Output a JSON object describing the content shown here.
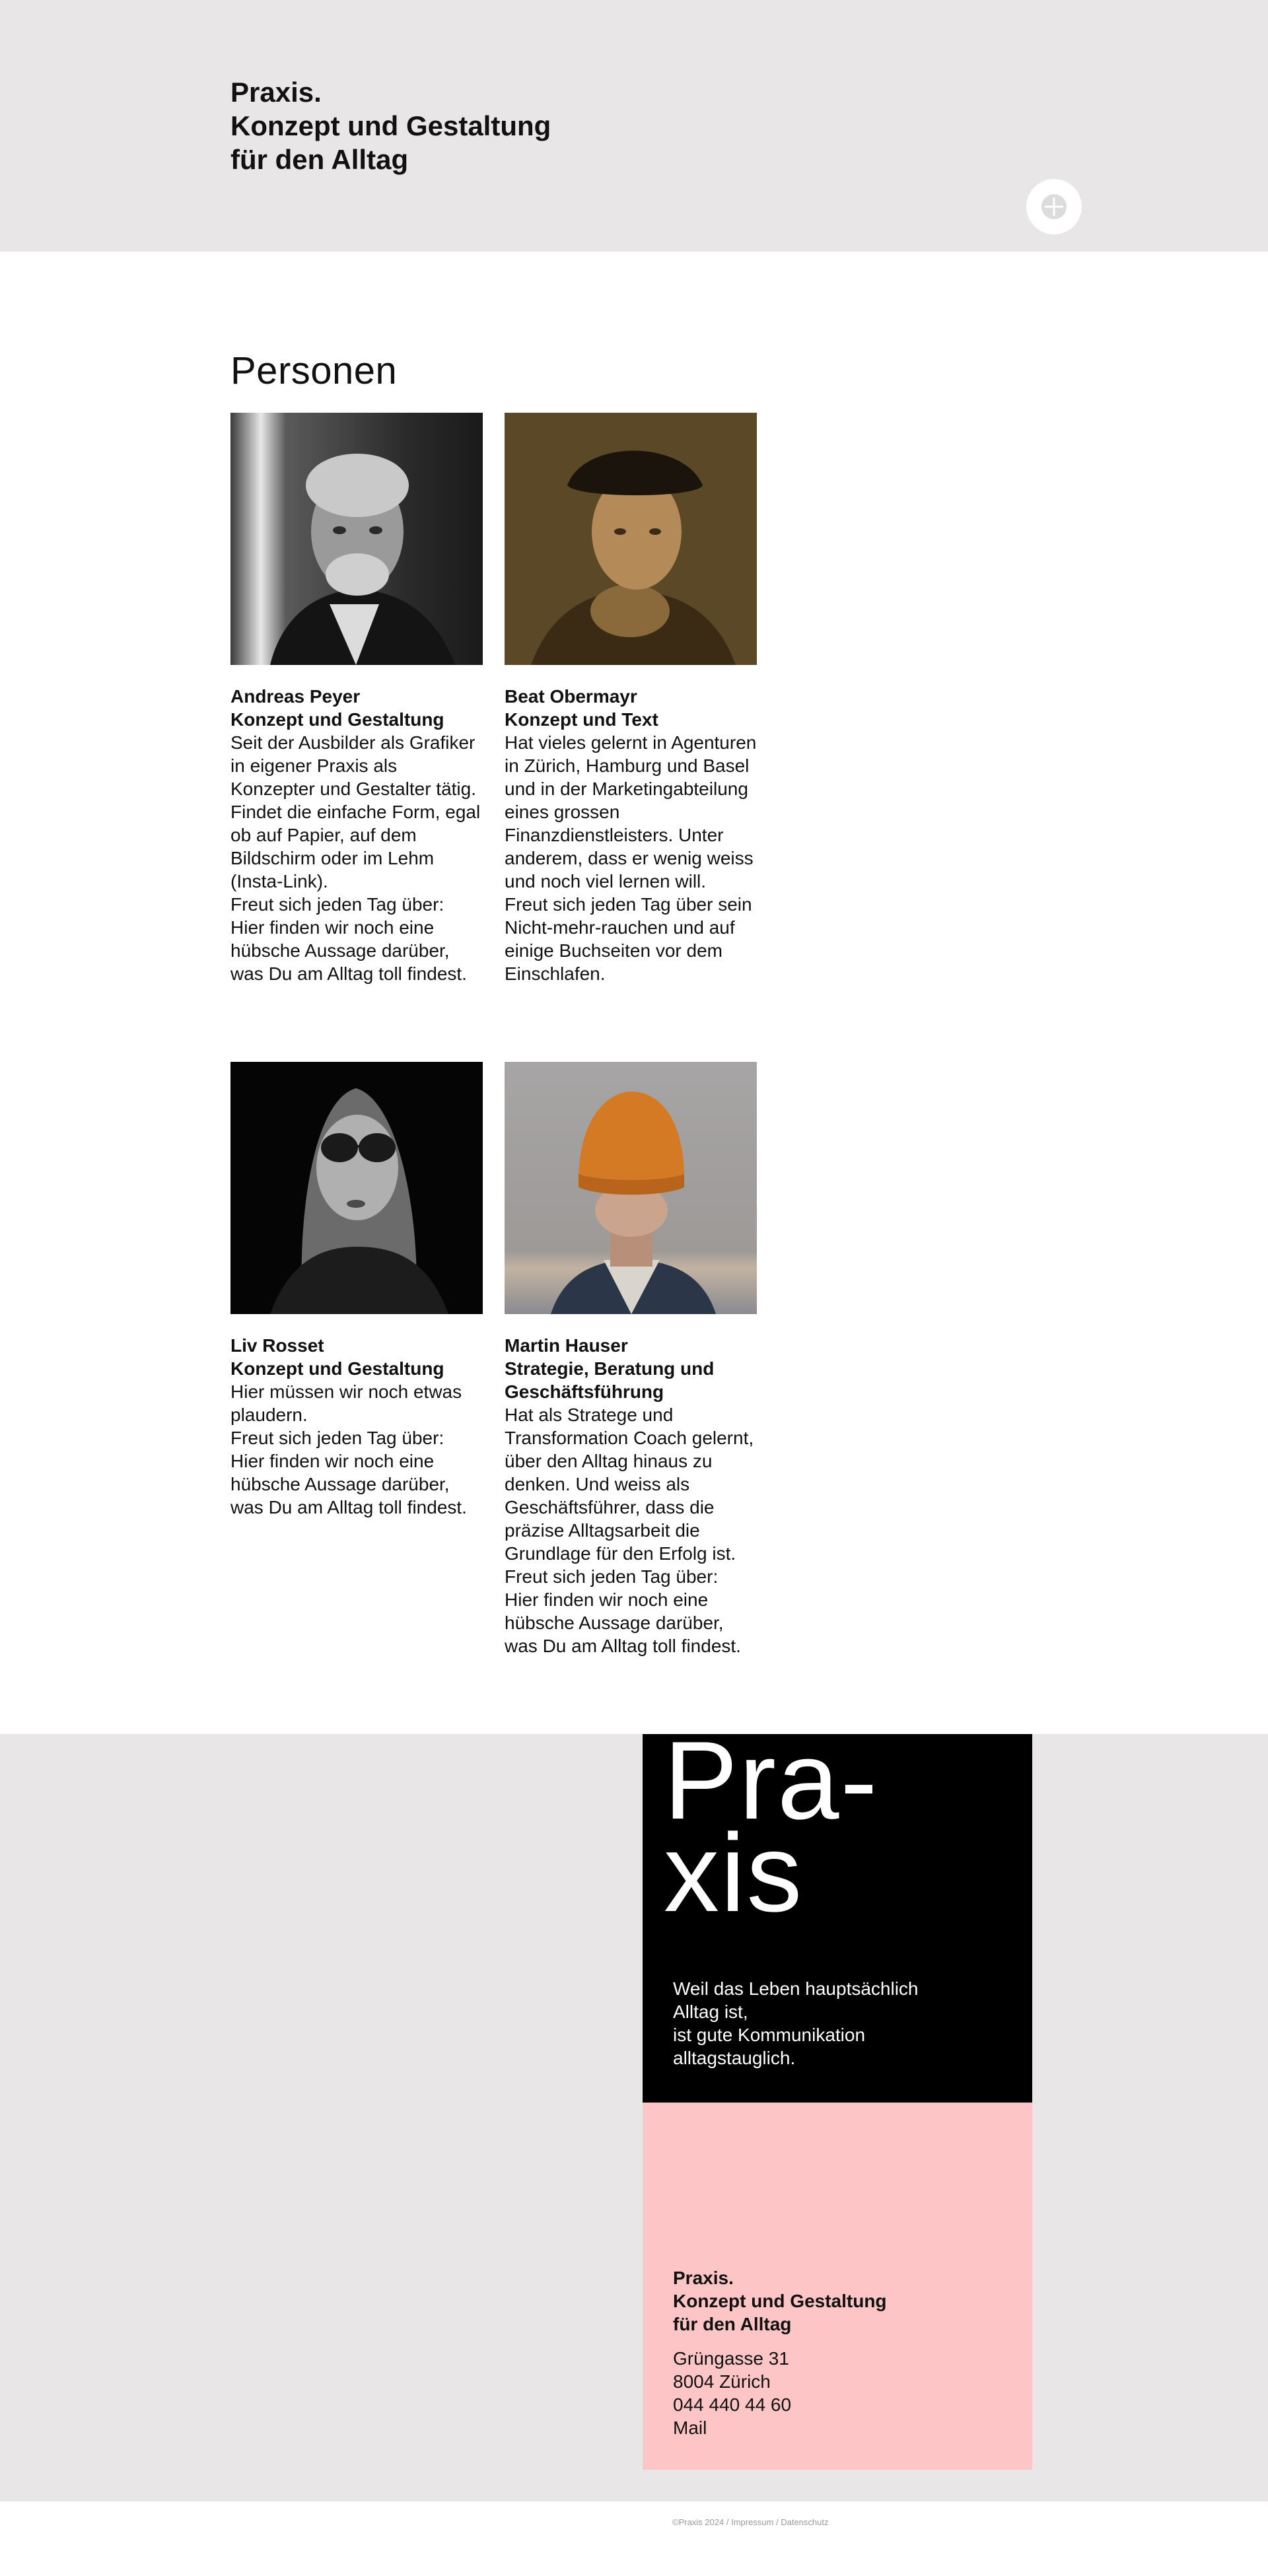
{
  "header": {
    "title_lines": [
      "Praxis.",
      "Konzept und Gestaltung",
      "für den Alltag"
    ],
    "menu_icon": "plus-icon"
  },
  "persons_section": {
    "title": "Personen",
    "people": [
      {
        "name": "Andreas Peyer",
        "role": "Konzept und Gestaltung",
        "bio": "Seit der Ausbilder als Grafiker in eigener Praxis als Konzepter und Gestalter tätig. Findet die einfache Form, egal ob auf Papier, auf dem Bildschirm oder im Lehm (Insta-Link).\nFreut sich jeden Tag über: Hier finden wir noch eine hübsche Aussage darüber, was Du am Alltag toll findest."
      },
      {
        "name": "Beat Obermayr",
        "role": "Konzept und Text",
        "bio": "Hat vieles gelernt in Agenturen in Zürich, Hamburg und Basel und in der Marketingabteilung eines grossen Finanzdienstleisters. Unter anderem, dass er wenig weiss und noch viel lernen will.\nFreut sich jeden Tag über sein Nicht-mehr-rauchen und auf einige Buchseiten vor dem Einschlafen."
      },
      {
        "name": "Liv Rosset",
        "role": "Konzept und Gestaltung",
        "bio": "Hier müssen wir noch etwas plaudern.\nFreut sich jeden Tag über: Hier finden wir noch eine hübsche Aussage darüber, was Du am Alltag toll findest."
      },
      {
        "name": "Martin Hauser",
        "role": "Strategie, Beratung und Geschäftsführung",
        "bio": "Hat als Stratege und Transformation Coach gelernt, über den Alltag hinaus zu denken. Und weiss als Geschäftsführer, dass die präzise Alltagsarbeit die Grundlage für den Erfolg ist.\nFreut sich jeden Tag über: Hier finden wir noch eine hübsche Aussage darüber, was Du am Alltag toll findest."
      }
    ]
  },
  "footer": {
    "logo_lines": [
      "Pra-",
      "xis"
    ],
    "tagline": "Weil das Leben hauptsächlich Alltag ist,\nist gute Kommunikation alltagstauglich.",
    "contact_title_lines": [
      "Praxis.",
      "Konzept und Gestaltung",
      "für den Alltag"
    ],
    "address_lines": [
      "Grüngasse 31",
      "8004 Zürich",
      "044 440 44 60"
    ],
    "mail_label": "Mail",
    "copyright": "©Praxis 2024",
    "impressum": "Impressum",
    "datenschutz": "Datenschutz",
    "separator": " / ",
    "colors": {
      "header_bg": "#e8e6e7",
      "black_card": "#000000",
      "pink_card": "#fdc5c6"
    }
  }
}
